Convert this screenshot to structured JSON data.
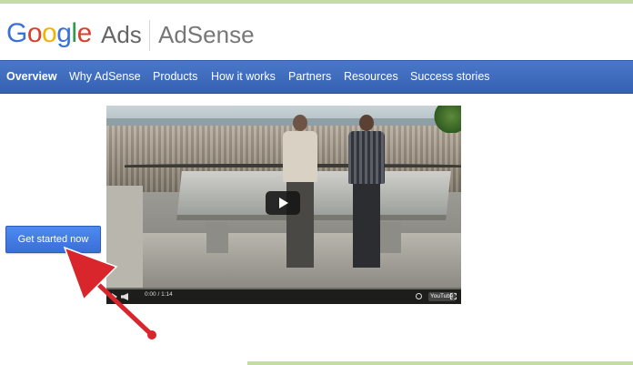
{
  "header": {
    "logo_letters": [
      "G",
      "o",
      "o",
      "g",
      "l",
      "e"
    ],
    "ads": "Ads",
    "product": "AdSense"
  },
  "nav": {
    "items": [
      {
        "label": "Overview"
      },
      {
        "label": "Why AdSense"
      },
      {
        "label": "Products"
      },
      {
        "label": "How it works"
      },
      {
        "label": "Partners"
      },
      {
        "label": "Resources"
      },
      {
        "label": "Success stories"
      }
    ]
  },
  "cta": {
    "label": "Get started now"
  },
  "video": {
    "time": "0:00 / 1:14",
    "brand": "YouTube"
  },
  "colors": {
    "nav_bg": "#3f6dbf",
    "cta_bg": "#4280e8",
    "arrow": "#d8262c",
    "accent_strip": "#c4dba6"
  }
}
